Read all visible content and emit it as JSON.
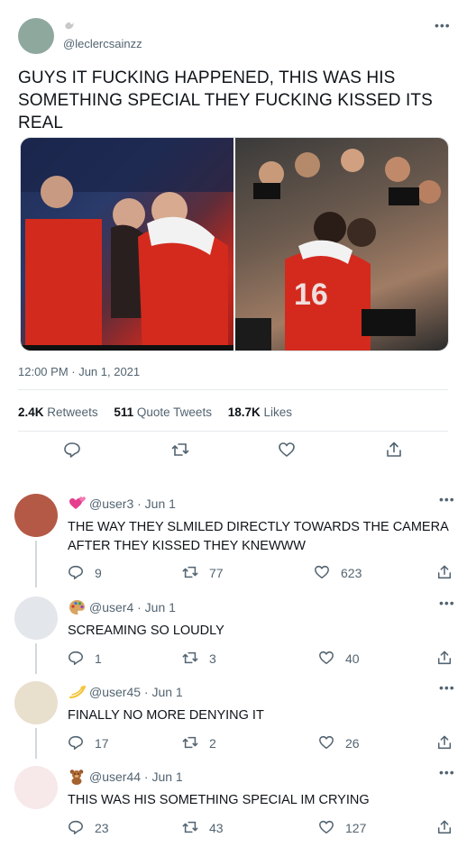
{
  "tweet": {
    "handle": "@leclercsainzz",
    "name_icon": "dove-emoji",
    "text_line1": "GUYS IT FUCKING HAPPENED, THIS WAS HIS",
    "text_line2": "SOMETHING SPECIAL THEY FUCKING KISSED ITS",
    "text_line3": "REAL",
    "timestamp": "12:00 PM · Jun 1, 2021",
    "stats": {
      "retweets_count": "2.4K",
      "retweets_label": "Retweets",
      "quotes_count": "511",
      "quotes_label": "Quote Tweets",
      "likes_count": "18.7K",
      "likes_label": "Likes"
    },
    "colors": {
      "avatar": "#8fa89e",
      "text": "#0f1419",
      "secondary": "#536471"
    }
  },
  "replies": [
    {
      "emoji": "hearts-emoji",
      "handle": "@user3",
      "date": "· Jun 1",
      "line1": "THE WAY THEY SLMILED DIRECTLY TOWARDS THE CAMERA",
      "line2": "AFTER THEY KISSED THEY KNEWWW",
      "replies": "9",
      "retweets": "77",
      "likes": "623",
      "avatar_color": "#b45945"
    },
    {
      "emoji": "palette-emoji",
      "handle": "@user4",
      "date": "· Jun 1",
      "line1": "SCREAMING SO LOUDLY",
      "replies": "1",
      "retweets": "3",
      "likes": "40",
      "avatar_color": "#e3e6ea"
    },
    {
      "emoji": "dizzy-emoji",
      "handle": "@user45",
      "date": "· Jun 1",
      "line1": "FINALLY NO MORE DENYING IT",
      "replies": "17",
      "retweets": "2",
      "likes": "26",
      "avatar_color": "#e9dfcd"
    },
    {
      "emoji": "teddy-bear-emoji",
      "handle": "@user44",
      "date": "· Jun 1",
      "line1": "THIS WAS HIS SOMETHING SPECIAL IM CRYING",
      "replies": "23",
      "retweets": "43",
      "likes": "127",
      "avatar_color": "#f7e8ea"
    }
  ]
}
